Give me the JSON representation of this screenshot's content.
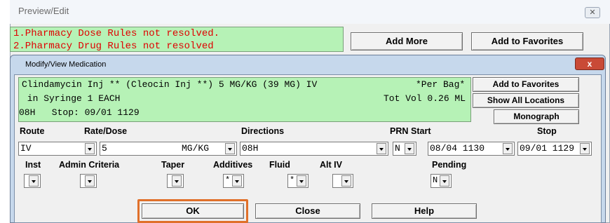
{
  "outer_window": {
    "title": "Preview/Edit",
    "close_glyph": "✕",
    "messages": [
      "1.Pharmacy Dose Rules not resolved.",
      "2.Pharmacy Drug Rules not resolved"
    ],
    "add_more_label": "Add More",
    "add_to_favorites_label": "Add to Favorites"
  },
  "dialog": {
    "title": "Modify/View Medication",
    "close_glyph": "x",
    "med_info": {
      "line1_left": "Clindamycin Inj ** (Cleocin Inj **) 5 MG/KG (39 MG) IV",
      "line1_right": "*Per Bag*",
      "line2_left": " in Syringe 1 EACH",
      "line2_right": "Tot Vol 0.26 ML",
      "line3_left": "08H   Stop: 09/01 1129"
    },
    "side_buttons": {
      "add_to_favorites": "Add to Favorites",
      "show_all_locations": "Show All Locations",
      "monograph": "Monograph"
    },
    "labels": {
      "route": "Route",
      "rate_dose": "Rate/Dose",
      "directions": "Directions",
      "prn": "PRN",
      "start": "Start",
      "stop": "Stop",
      "inst": "Inst",
      "admin_criteria": "Admin Criteria",
      "taper": "Taper",
      "additives": "Additives",
      "fluid": "Fluid",
      "alt_iv": "Alt IV",
      "pending": "Pending"
    },
    "fields": {
      "route": "IV",
      "dose": "5",
      "unit": "MG/KG",
      "directions": "08H",
      "prn": "N",
      "start": "08/04 1130",
      "stop": "09/01 1129"
    },
    "mini": {
      "additives": "*",
      "fluid": "*",
      "pending": "N"
    },
    "buttons": {
      "ok": "OK",
      "close": "Close",
      "help": "Help"
    },
    "colors": {
      "message_bg": "#b6f2b6",
      "error_text": "#e00000",
      "ok_highlight": "#e0702a"
    }
  }
}
